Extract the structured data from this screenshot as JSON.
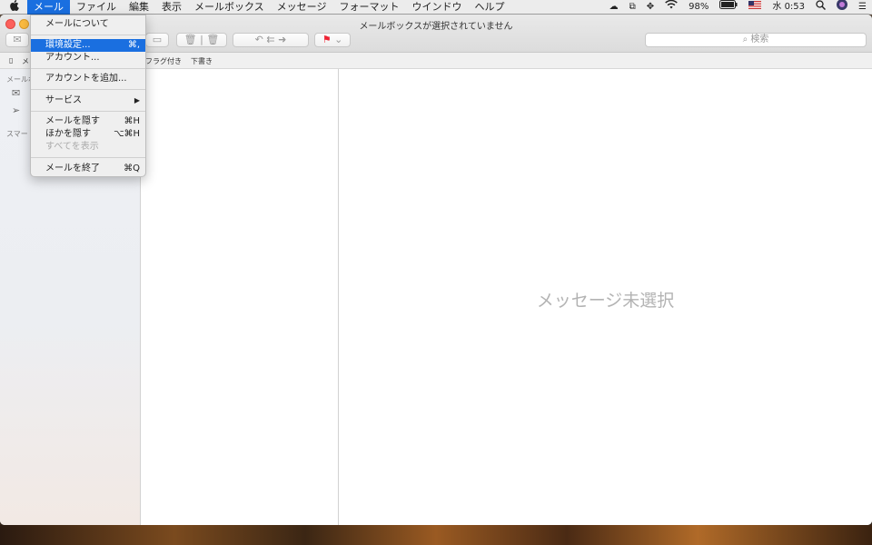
{
  "menubar": {
    "apple_icon": "apple-icon",
    "items": [
      "メール",
      "ファイル",
      "編集",
      "表示",
      "メールボックス",
      "メッセージ",
      "フォーマット",
      "ウインドウ",
      "ヘルプ"
    ],
    "battery": "98%",
    "clock": "水 0:53",
    "status_icons": [
      "cloud-icon",
      "window-icon",
      "move-icon",
      "wifi-icon",
      "battery-icon",
      "flag-us-icon",
      "search-icon",
      "siri-icon",
      "list-icon"
    ]
  },
  "window": {
    "title": "メールボックスが選択されていません",
    "search_placeholder": "検索",
    "favorites": {
      "mailbox_label": "メ",
      "flagged": "フラグ付き",
      "drafts": "下書き"
    }
  },
  "sidebar": {
    "section_mailbox": "メールボ",
    "section_smart": "スマート"
  },
  "content": {
    "no_message": "メッセージ未選択"
  },
  "menu": {
    "about": "メールについて",
    "preferences": "環境設定...",
    "preferences_shortcut": "⌘,",
    "accounts": "アカウント...",
    "add_account": "アカウントを追加...",
    "services": "サービス",
    "hide_mail": "メールを隠す",
    "hide_mail_shortcut": "⌘H",
    "hide_others": "ほかを隠す",
    "hide_others_shortcut": "⌥⌘H",
    "show_all": "すべてを表示",
    "quit": "メールを終了",
    "quit_shortcut": "⌘Q"
  },
  "colors": {
    "highlight": "#1a6fe0",
    "close": "#fc605b",
    "minimize": "#fdbc40"
  }
}
